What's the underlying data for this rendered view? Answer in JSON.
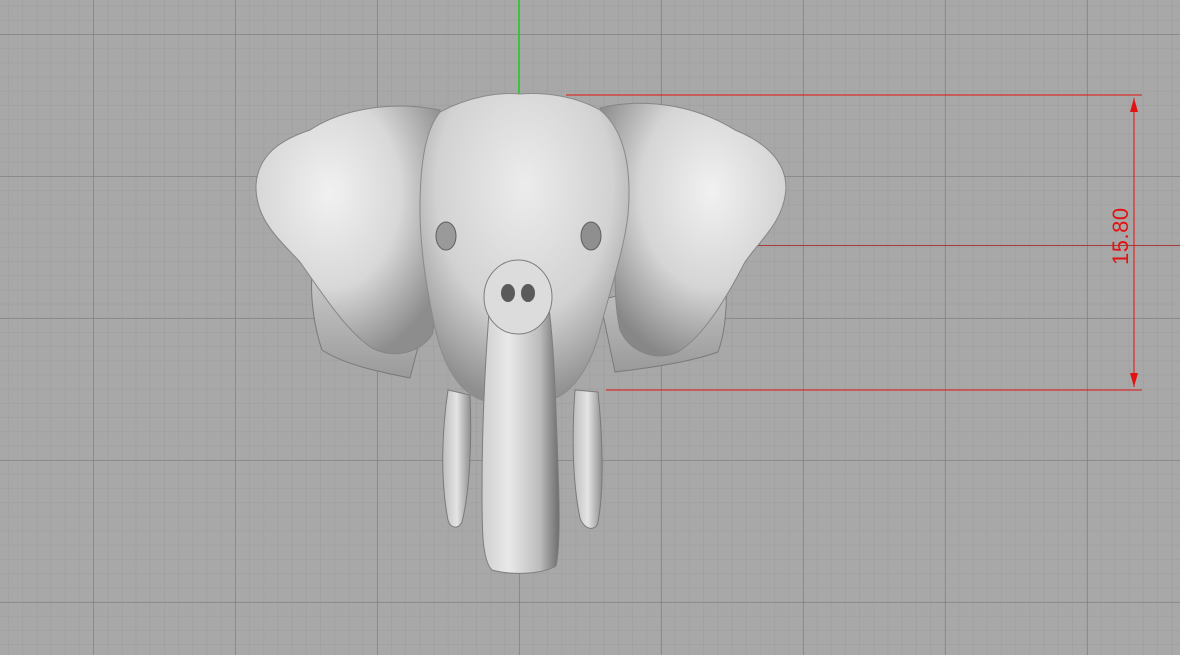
{
  "viewport": {
    "dimension_label": "15.80"
  },
  "colors": {
    "background": "#a8a8a8",
    "grid": "#8a8a8a",
    "y_axis": "#39c43b",
    "x_axis": "#a53b3b",
    "dimension": "#e21212",
    "model_light": "#e6e6e6",
    "model_dark": "#4a4a4a"
  },
  "icons": {
    "model": "elephant-head-model",
    "dimension": "linear-dimension"
  }
}
